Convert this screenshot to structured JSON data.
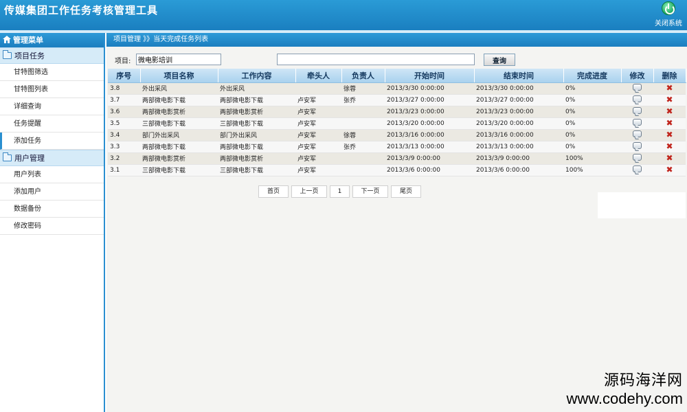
{
  "app": {
    "title": "传媒集团工作任务考核管理工具",
    "close_label": "关闭系统"
  },
  "sidebar": {
    "header": "管理菜单",
    "groups": [
      {
        "label": "项目任务",
        "items": [
          "甘特图筛选",
          "甘特图列表",
          "详细查询",
          "任务提醒",
          "添加任务"
        ]
      },
      {
        "label": "用户管理",
        "items": [
          "用户列表",
          "添加用户",
          "数据备份",
          "修改密码"
        ]
      }
    ]
  },
  "main": {
    "breadcrumb": "项目管理 》》当天完成任务列表",
    "search": {
      "label": "项目:",
      "project_value": "微电影培训",
      "keyword_value": "",
      "button": "查询"
    },
    "columns": [
      "序号",
      "项目名称",
      "工作内容",
      "牵头人",
      "负责人",
      "开始时间",
      "结束时间",
      "完成进度",
      "修改",
      "删除"
    ],
    "rows": [
      [
        "3.8",
        "外出采风",
        "外出采风",
        "",
        "徐蓉",
        "2013/3/30 0:00:00",
        "2013/3/30 0:00:00",
        "0%"
      ],
      [
        "3.7",
        "两部微电影下载",
        "两部微电影下载",
        "卢安军",
        "张乔",
        "2013/3/27 0:00:00",
        "2013/3/27 0:00:00",
        "0%"
      ],
      [
        "3.6",
        "两部微电影赏析",
        "两部微电影赏析",
        "卢安军",
        "",
        "2013/3/23 0:00:00",
        "2013/3/23 0:00:00",
        "0%"
      ],
      [
        "3.5",
        "三部微电影下载",
        "三部微电影下载",
        "卢安军",
        "",
        "2013/3/20 0:00:00",
        "2013/3/20 0:00:00",
        "0%"
      ],
      [
        "3.4",
        "部门外出采风",
        "部门外出采风",
        "卢安军",
        "徐蓉",
        "2013/3/16 0:00:00",
        "2013/3/16 0:00:00",
        "0%"
      ],
      [
        "3.3",
        "两部微电影下载",
        "两部微电影下载",
        "卢安军",
        "张乔",
        "2013/3/13 0:00:00",
        "2013/3/13 0:00:00",
        "0%"
      ],
      [
        "3.2",
        "两部微电影赏析",
        "两部微电影赏析",
        "卢安军",
        "",
        "2013/3/9 0:00:00",
        "2013/3/9 0:00:00",
        "100%"
      ],
      [
        "3.1",
        "三部微电影下载",
        "三部微电影下载",
        "卢安军",
        "",
        "2013/3/6 0:00:00",
        "2013/3/6 0:00:00",
        "100%"
      ]
    ],
    "pager": {
      "first": "首页",
      "prev": "上一页",
      "page": "1",
      "next": "下一页",
      "last": "尾页"
    }
  },
  "watermark": {
    "name": "源码海洋网",
    "url": "www.codehy.com"
  }
}
